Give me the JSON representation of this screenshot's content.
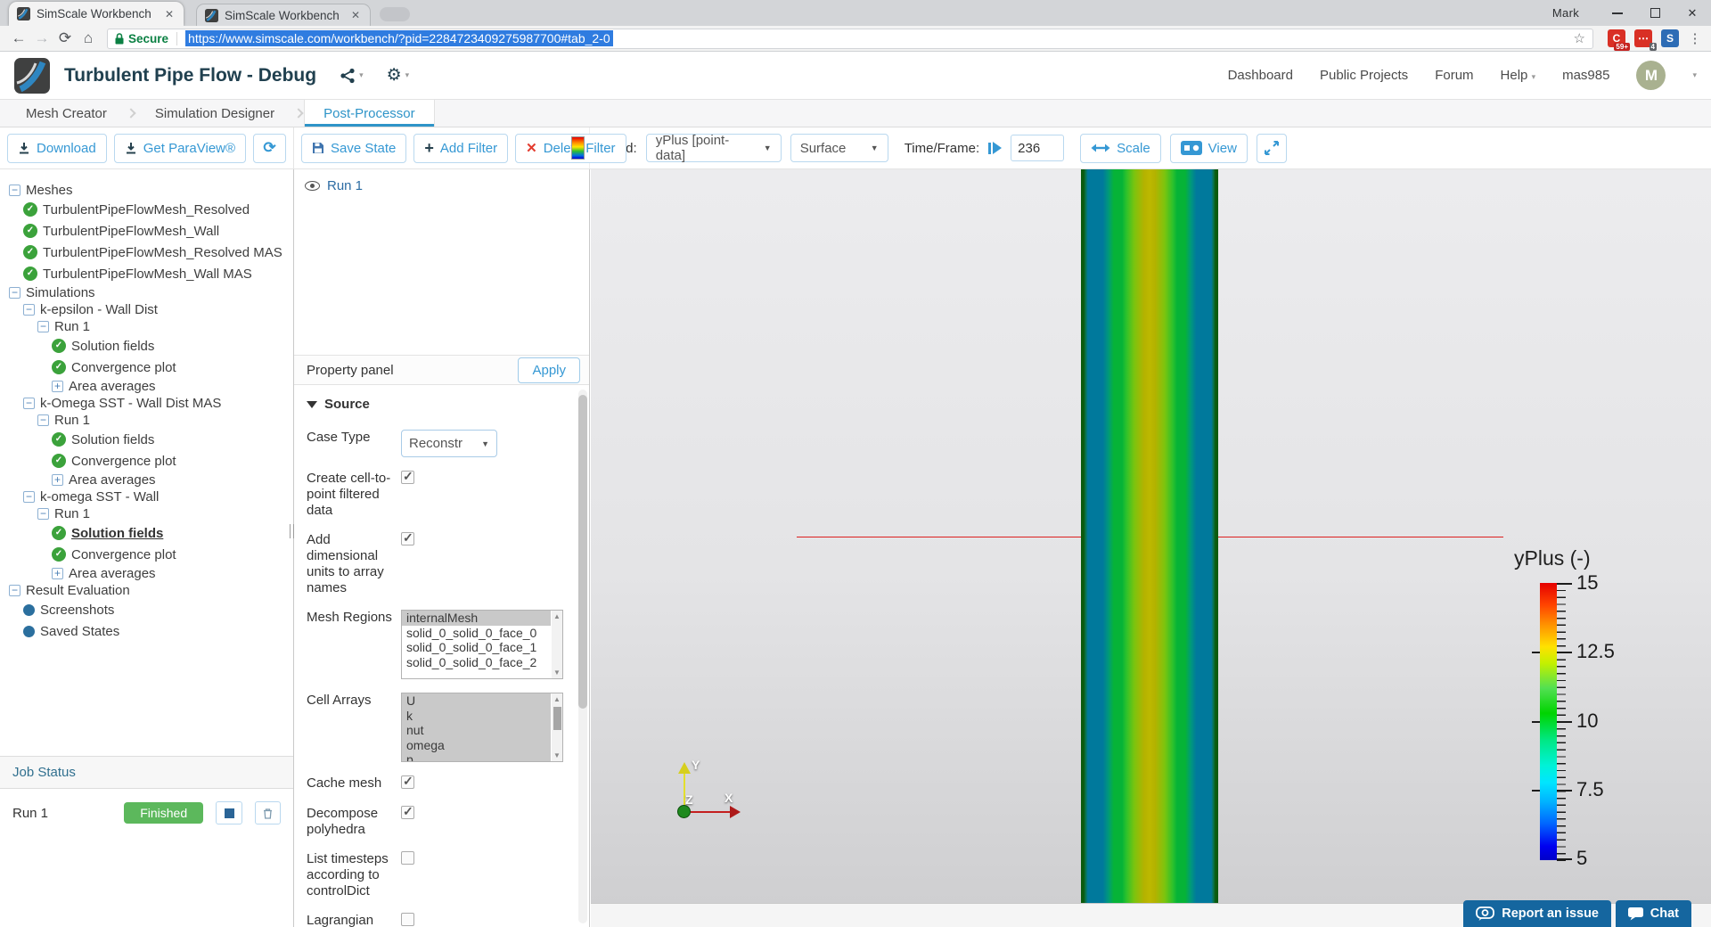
{
  "browser": {
    "tabs": [
      {
        "title": "SimScale Workbench"
      },
      {
        "title": "SimScale Workbench"
      }
    ],
    "profile_name": "Mark",
    "address": {
      "secure_label": "Secure",
      "url": "https://www.simscale.com/workbench/?pid=2284723409275987700#tab_2-0"
    },
    "extensions": [
      {
        "label": "C",
        "badge": "59+",
        "color": "#d93025"
      },
      {
        "label": "⋯",
        "badge": "4",
        "color": "#d93025"
      },
      {
        "label": "S",
        "badge": "",
        "color": "#2d6cb5"
      }
    ]
  },
  "header": {
    "title": "Turbulent Pipe Flow - Debug",
    "nav": [
      {
        "label": "Dashboard"
      },
      {
        "label": "Public Projects"
      },
      {
        "label": "Forum"
      },
      {
        "label": "Help"
      },
      {
        "label": "mas985"
      }
    ],
    "avatar_initial": "M"
  },
  "workbench_tabs": [
    {
      "label": "Mesh Creator",
      "active": false
    },
    {
      "label": "Simulation Designer",
      "active": false
    },
    {
      "label": "Post-Processor",
      "active": true
    }
  ],
  "left_toolbar": {
    "download": "Download",
    "get_paraview": "Get ParaView®"
  },
  "pp_toolbar": {
    "save_state": "Save State",
    "add_filter": "Add Filter",
    "delete_filter": "Delete Filter",
    "field_label": "Field:",
    "field_value": "yPlus [point-data]",
    "representation": "Surface",
    "time_label": "Time/Frame:",
    "time_value": "236",
    "scale": "Scale",
    "view": "View"
  },
  "pipeline": {
    "items": [
      {
        "label": "Run 1"
      }
    ]
  },
  "tree": {
    "items": [
      {
        "depth": 0,
        "icon": "collapse",
        "label": "Meshes"
      },
      {
        "depth": 1,
        "icon": "check",
        "label": "TurbulentPipeFlowMesh_Resolved",
        "spaced": true
      },
      {
        "depth": 1,
        "icon": "check",
        "label": "TurbulentPipeFlowMesh_Wall",
        "spaced": true
      },
      {
        "depth": 1,
        "icon": "check",
        "label": "TurbulentPipeFlowMesh_Resolved MAS",
        "spaced": true
      },
      {
        "depth": 1,
        "icon": "check",
        "label": "TurbulentPipeFlowMesh_Wall MAS",
        "spaced": true
      },
      {
        "depth": 0,
        "icon": "collapse",
        "label": "Simulations"
      },
      {
        "depth": 1,
        "icon": "collapse",
        "label": "k-epsilon - Wall Dist"
      },
      {
        "depth": 2,
        "icon": "collapse",
        "label": "Run 1"
      },
      {
        "depth": 3,
        "icon": "check",
        "label": "Solution fields",
        "spaced": true
      },
      {
        "depth": 3,
        "icon": "check",
        "label": "Convergence plot",
        "spaced": true
      },
      {
        "depth": 3,
        "icon": "expand",
        "label": "Area averages"
      },
      {
        "depth": 1,
        "icon": "collapse",
        "label": "k-Omega SST - Wall Dist MAS"
      },
      {
        "depth": 2,
        "icon": "collapse",
        "label": "Run 1"
      },
      {
        "depth": 3,
        "icon": "check",
        "label": "Solution fields",
        "spaced": true
      },
      {
        "depth": 3,
        "icon": "check",
        "label": "Convergence plot",
        "spaced": true
      },
      {
        "depth": 3,
        "icon": "expand",
        "label": "Area averages"
      },
      {
        "depth": 1,
        "icon": "collapse",
        "label": "k-omega SST - Wall"
      },
      {
        "depth": 2,
        "icon": "collapse",
        "label": "Run 1"
      },
      {
        "depth": 3,
        "icon": "check",
        "label": "Solution fields",
        "selected": true,
        "spaced": true
      },
      {
        "depth": 3,
        "icon": "check",
        "label": "Convergence plot",
        "spaced": true
      },
      {
        "depth": 3,
        "icon": "expand",
        "label": "Area averages"
      },
      {
        "depth": 0,
        "icon": "collapse",
        "label": "Result Evaluation"
      },
      {
        "depth": 1,
        "icon": "dot",
        "label": "Screenshots",
        "spaced": true
      },
      {
        "depth": 1,
        "icon": "dot",
        "label": "Saved States",
        "spaced": true
      }
    ]
  },
  "job_status": {
    "header": "Job Status",
    "rows": [
      {
        "name": "Run 1",
        "status": "Finished"
      }
    ]
  },
  "property_panel": {
    "header": "Property panel",
    "apply": "Apply",
    "section": "Source",
    "case_type": {
      "label": "Case Type",
      "value": "Reconstr"
    },
    "create_cell_label": "Create cell-to-point filtered data",
    "add_units_label": "Add dimensional units to array names",
    "mesh_regions": {
      "label": "Mesh Regions",
      "items": [
        "internalMesh",
        "solid_0_solid_0_face_0",
        "solid_0_solid_0_face_1",
        "solid_0_solid_0_face_2"
      ],
      "selected_index": 0
    },
    "cell_arrays": {
      "label": "Cell Arrays",
      "items": [
        "U",
        "k",
        "nut",
        "omega",
        "p"
      ],
      "all_selected": true
    },
    "cache_mesh_label": "Cache mesh",
    "decompose_label": "Decompose polyhedra",
    "list_timesteps_label": "List timesteps according to controlDict",
    "lagrangian_label": "Lagrangian",
    "checks": {
      "create_cell": true,
      "add_units": true,
      "cache_mesh": true,
      "decompose": true,
      "list_timesteps": false,
      "lagrangian": false
    }
  },
  "viewport": {
    "legend": {
      "title": "yPlus (-)",
      "tick_labels": [
        "15",
        "12.5",
        "10",
        "7.5",
        "5"
      ]
    },
    "axes": {
      "x": "X",
      "y": "Y",
      "z": "Z"
    },
    "line_color": "#dc1f1f"
  },
  "footer": {
    "report": "Report an issue",
    "chat": "Chat"
  }
}
